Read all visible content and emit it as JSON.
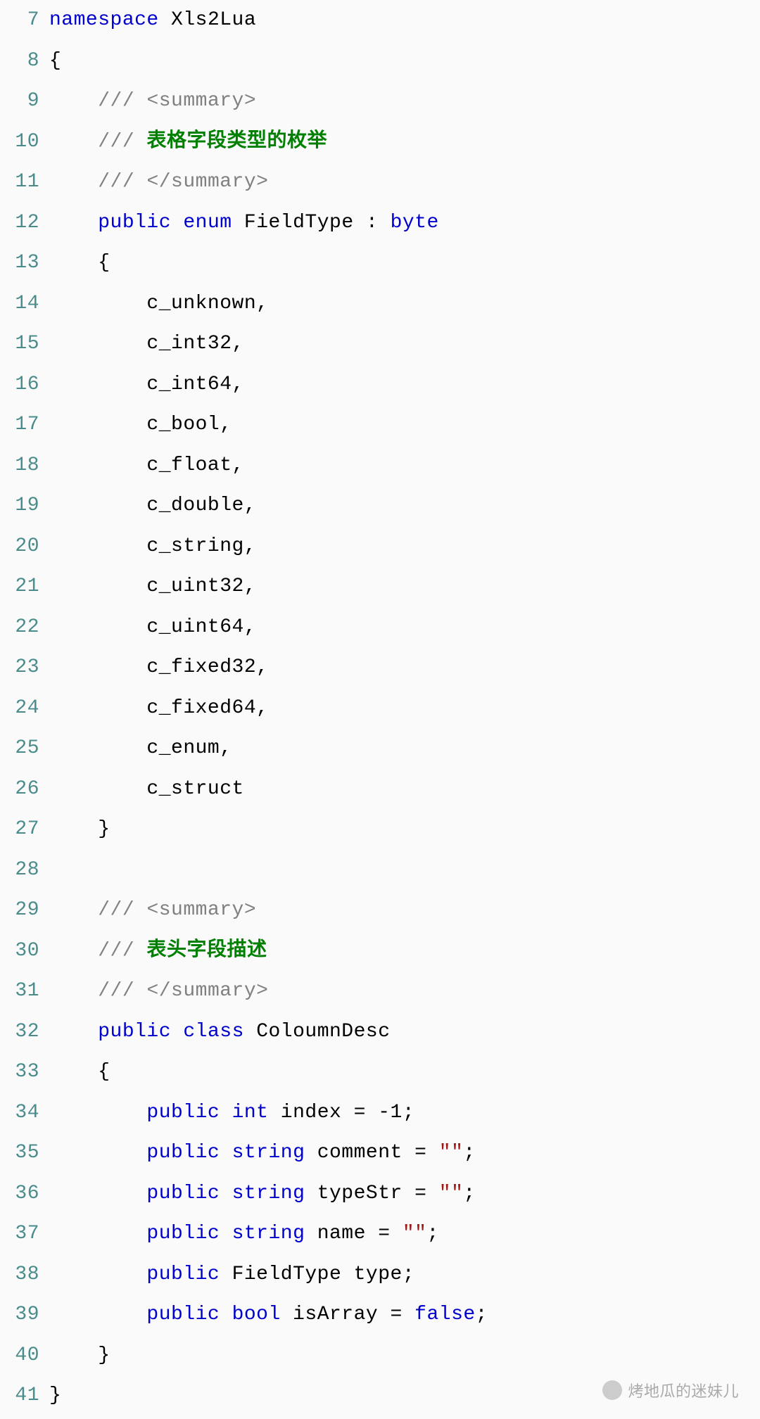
{
  "lines": [
    {
      "num": "7",
      "tokens": [
        {
          "cls": "kw",
          "t": "namespace"
        },
        {
          "cls": "",
          "t": " "
        },
        {
          "cls": "ident",
          "t": "Xls2Lua"
        }
      ]
    },
    {
      "num": "8",
      "tokens": [
        {
          "cls": "punct",
          "t": "{"
        }
      ]
    },
    {
      "num": "9",
      "tokens": [
        {
          "cls": "",
          "t": "    "
        },
        {
          "cls": "comment-slash",
          "t": "/// "
        },
        {
          "cls": "xml-tag",
          "t": "<summary>"
        }
      ]
    },
    {
      "num": "10",
      "tokens": [
        {
          "cls": "",
          "t": "    "
        },
        {
          "cls": "comment-slash",
          "t": "/// "
        },
        {
          "cls": "comment-text",
          "t": "表格字段类型的枚举"
        }
      ]
    },
    {
      "num": "11",
      "tokens": [
        {
          "cls": "",
          "t": "    "
        },
        {
          "cls": "comment-slash",
          "t": "/// "
        },
        {
          "cls": "xml-tag",
          "t": "</summary>"
        }
      ]
    },
    {
      "num": "12",
      "tokens": [
        {
          "cls": "",
          "t": "    "
        },
        {
          "cls": "kw",
          "t": "public"
        },
        {
          "cls": "",
          "t": " "
        },
        {
          "cls": "kw",
          "t": "enum"
        },
        {
          "cls": "",
          "t": " "
        },
        {
          "cls": "ident",
          "t": "FieldType"
        },
        {
          "cls": "",
          "t": " "
        },
        {
          "cls": "punct",
          "t": ":"
        },
        {
          "cls": "",
          "t": " "
        },
        {
          "cls": "type",
          "t": "byte"
        }
      ]
    },
    {
      "num": "13",
      "tokens": [
        {
          "cls": "",
          "t": "    "
        },
        {
          "cls": "punct",
          "t": "{"
        }
      ]
    },
    {
      "num": "14",
      "tokens": [
        {
          "cls": "",
          "t": "        "
        },
        {
          "cls": "ident",
          "t": "c_unknown"
        },
        {
          "cls": "punct",
          "t": ","
        }
      ]
    },
    {
      "num": "15",
      "tokens": [
        {
          "cls": "",
          "t": "        "
        },
        {
          "cls": "ident",
          "t": "c_int32"
        },
        {
          "cls": "punct",
          "t": ","
        }
      ]
    },
    {
      "num": "16",
      "tokens": [
        {
          "cls": "",
          "t": "        "
        },
        {
          "cls": "ident",
          "t": "c_int64"
        },
        {
          "cls": "punct",
          "t": ","
        }
      ]
    },
    {
      "num": "17",
      "tokens": [
        {
          "cls": "",
          "t": "        "
        },
        {
          "cls": "ident",
          "t": "c_bool"
        },
        {
          "cls": "punct",
          "t": ","
        }
      ]
    },
    {
      "num": "18",
      "tokens": [
        {
          "cls": "",
          "t": "        "
        },
        {
          "cls": "ident",
          "t": "c_float"
        },
        {
          "cls": "punct",
          "t": ","
        }
      ]
    },
    {
      "num": "19",
      "tokens": [
        {
          "cls": "",
          "t": "        "
        },
        {
          "cls": "ident",
          "t": "c_double"
        },
        {
          "cls": "punct",
          "t": ","
        }
      ]
    },
    {
      "num": "20",
      "tokens": [
        {
          "cls": "",
          "t": "        "
        },
        {
          "cls": "ident",
          "t": "c_string"
        },
        {
          "cls": "punct",
          "t": ","
        }
      ]
    },
    {
      "num": "21",
      "tokens": [
        {
          "cls": "",
          "t": "        "
        },
        {
          "cls": "ident",
          "t": "c_uint32"
        },
        {
          "cls": "punct",
          "t": ","
        }
      ]
    },
    {
      "num": "22",
      "tokens": [
        {
          "cls": "",
          "t": "        "
        },
        {
          "cls": "ident",
          "t": "c_uint64"
        },
        {
          "cls": "punct",
          "t": ","
        }
      ]
    },
    {
      "num": "23",
      "tokens": [
        {
          "cls": "",
          "t": "        "
        },
        {
          "cls": "ident",
          "t": "c_fixed32"
        },
        {
          "cls": "punct",
          "t": ","
        }
      ]
    },
    {
      "num": "24",
      "tokens": [
        {
          "cls": "",
          "t": "        "
        },
        {
          "cls": "ident",
          "t": "c_fixed64"
        },
        {
          "cls": "punct",
          "t": ","
        }
      ]
    },
    {
      "num": "25",
      "tokens": [
        {
          "cls": "",
          "t": "        "
        },
        {
          "cls": "ident",
          "t": "c_enum"
        },
        {
          "cls": "punct",
          "t": ","
        }
      ]
    },
    {
      "num": "26",
      "tokens": [
        {
          "cls": "",
          "t": "        "
        },
        {
          "cls": "ident",
          "t": "c_struct"
        }
      ]
    },
    {
      "num": "27",
      "tokens": [
        {
          "cls": "",
          "t": "    "
        },
        {
          "cls": "punct",
          "t": "}"
        }
      ]
    },
    {
      "num": "28",
      "tokens": []
    },
    {
      "num": "29",
      "tokens": [
        {
          "cls": "",
          "t": "    "
        },
        {
          "cls": "comment-slash",
          "t": "/// "
        },
        {
          "cls": "xml-tag",
          "t": "<summary>"
        }
      ]
    },
    {
      "num": "30",
      "tokens": [
        {
          "cls": "",
          "t": "    "
        },
        {
          "cls": "comment-slash",
          "t": "/// "
        },
        {
          "cls": "comment-text",
          "t": "表头字段描述"
        }
      ]
    },
    {
      "num": "31",
      "tokens": [
        {
          "cls": "",
          "t": "    "
        },
        {
          "cls": "comment-slash",
          "t": "/// "
        },
        {
          "cls": "xml-tag",
          "t": "</summary>"
        }
      ]
    },
    {
      "num": "32",
      "tokens": [
        {
          "cls": "",
          "t": "    "
        },
        {
          "cls": "kw",
          "t": "public"
        },
        {
          "cls": "",
          "t": " "
        },
        {
          "cls": "kw",
          "t": "class"
        },
        {
          "cls": "",
          "t": " "
        },
        {
          "cls": "ident",
          "t": "ColoumnDesc"
        }
      ]
    },
    {
      "num": "33",
      "tokens": [
        {
          "cls": "",
          "t": "    "
        },
        {
          "cls": "punct",
          "t": "{"
        }
      ]
    },
    {
      "num": "34",
      "tokens": [
        {
          "cls": "",
          "t": "        "
        },
        {
          "cls": "kw",
          "t": "public"
        },
        {
          "cls": "",
          "t": " "
        },
        {
          "cls": "type",
          "t": "int"
        },
        {
          "cls": "",
          "t": " "
        },
        {
          "cls": "ident",
          "t": "index"
        },
        {
          "cls": "",
          "t": " "
        },
        {
          "cls": "punct",
          "t": "="
        },
        {
          "cls": "",
          "t": " "
        },
        {
          "cls": "num",
          "t": "-1"
        },
        {
          "cls": "punct",
          "t": ";"
        }
      ]
    },
    {
      "num": "35",
      "tokens": [
        {
          "cls": "",
          "t": "        "
        },
        {
          "cls": "kw",
          "t": "public"
        },
        {
          "cls": "",
          "t": " "
        },
        {
          "cls": "type",
          "t": "string"
        },
        {
          "cls": "",
          "t": " "
        },
        {
          "cls": "ident",
          "t": "comment"
        },
        {
          "cls": "",
          "t": " "
        },
        {
          "cls": "punct",
          "t": "="
        },
        {
          "cls": "",
          "t": " "
        },
        {
          "cls": "str",
          "t": "\"\""
        },
        {
          "cls": "punct",
          "t": ";"
        }
      ]
    },
    {
      "num": "36",
      "tokens": [
        {
          "cls": "",
          "t": "        "
        },
        {
          "cls": "kw",
          "t": "public"
        },
        {
          "cls": "",
          "t": " "
        },
        {
          "cls": "type",
          "t": "string"
        },
        {
          "cls": "",
          "t": " "
        },
        {
          "cls": "ident",
          "t": "typeStr"
        },
        {
          "cls": "",
          "t": " "
        },
        {
          "cls": "punct",
          "t": "="
        },
        {
          "cls": "",
          "t": " "
        },
        {
          "cls": "str",
          "t": "\"\""
        },
        {
          "cls": "punct",
          "t": ";"
        }
      ]
    },
    {
      "num": "37",
      "tokens": [
        {
          "cls": "",
          "t": "        "
        },
        {
          "cls": "kw",
          "t": "public"
        },
        {
          "cls": "",
          "t": " "
        },
        {
          "cls": "type",
          "t": "string"
        },
        {
          "cls": "",
          "t": " "
        },
        {
          "cls": "ident",
          "t": "name"
        },
        {
          "cls": "",
          "t": " "
        },
        {
          "cls": "punct",
          "t": "="
        },
        {
          "cls": "",
          "t": " "
        },
        {
          "cls": "str",
          "t": "\"\""
        },
        {
          "cls": "punct",
          "t": ";"
        }
      ]
    },
    {
      "num": "38",
      "tokens": [
        {
          "cls": "",
          "t": "        "
        },
        {
          "cls": "kw",
          "t": "public"
        },
        {
          "cls": "",
          "t": " "
        },
        {
          "cls": "ident",
          "t": "FieldType"
        },
        {
          "cls": "",
          "t": " "
        },
        {
          "cls": "ident",
          "t": "type"
        },
        {
          "cls": "punct",
          "t": ";"
        }
      ]
    },
    {
      "num": "39",
      "tokens": [
        {
          "cls": "",
          "t": "        "
        },
        {
          "cls": "kw",
          "t": "public"
        },
        {
          "cls": "",
          "t": " "
        },
        {
          "cls": "type",
          "t": "bool"
        },
        {
          "cls": "",
          "t": " "
        },
        {
          "cls": "ident",
          "t": "isArray"
        },
        {
          "cls": "",
          "t": " "
        },
        {
          "cls": "punct",
          "t": "="
        },
        {
          "cls": "",
          "t": " "
        },
        {
          "cls": "kw",
          "t": "false"
        },
        {
          "cls": "punct",
          "t": ";"
        }
      ]
    },
    {
      "num": "40",
      "tokens": [
        {
          "cls": "",
          "t": "    "
        },
        {
          "cls": "punct",
          "t": "}"
        }
      ]
    },
    {
      "num": "41",
      "tokens": [
        {
          "cls": "punct",
          "t": "}"
        }
      ]
    }
  ],
  "watermark": "烤地瓜的迷妹儿"
}
